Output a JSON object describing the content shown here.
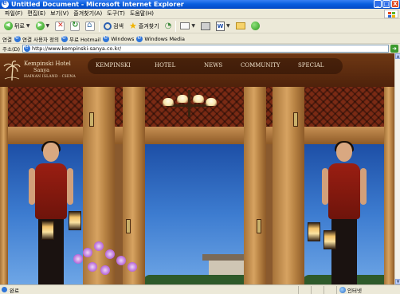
{
  "window": {
    "title": "Untitled Document - Microsoft Internet Explorer",
    "buttons": {
      "minimize": "_",
      "maximize": "□",
      "close": "X"
    }
  },
  "menubar": {
    "items": [
      "파일(F)",
      "편집(E)",
      "보기(V)",
      "즐겨찾기(A)",
      "도구(T)",
      "도움말(H)"
    ]
  },
  "toolbar": {
    "back_label": "뒤로",
    "search_label": "검색",
    "favorites_label": "즐겨찾기",
    "word_label": "W"
  },
  "links_bar": {
    "label": "연결",
    "items": [
      "연결 사용자 정의",
      "무료 Hotmail",
      "Windows",
      "Windows Media"
    ]
  },
  "address_bar": {
    "label": "주소(D)",
    "url": "http://www.kempinski-sanya.co.kr/"
  },
  "site": {
    "brand_line_1": "Kempinski Hotel",
    "brand_line_2": "Sanya",
    "brand_line_3": "HAINAN ISLAND · CHINA",
    "nav": [
      "KEMPINSKI",
      "HOTEL",
      "NEWS",
      "COMMUNITY",
      "SPECIAL"
    ]
  },
  "statusbar": {
    "left_text": "완료",
    "zone_text": "인터넷"
  },
  "colors": {
    "titlebar": "#0a5fe0",
    "header_brown": "#5a2a10",
    "nav_text": "#f3e6cf"
  }
}
